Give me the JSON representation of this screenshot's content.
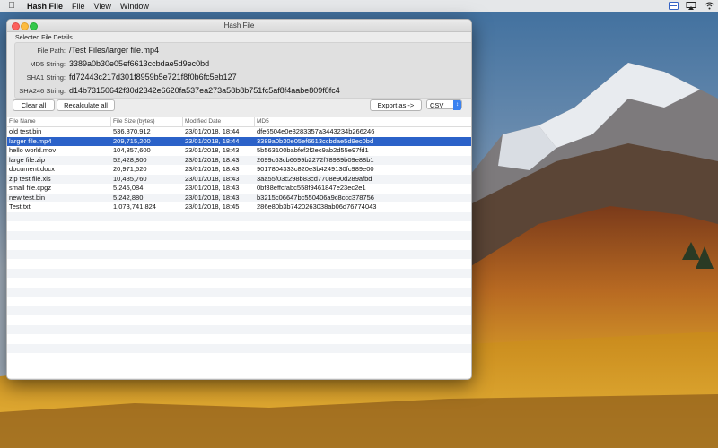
{
  "menubar": {
    "app_name": "Hash File",
    "menus": [
      "File",
      "View",
      "Window"
    ]
  },
  "window": {
    "title": "Hash File"
  },
  "details": {
    "section_title": "Selected File Details...",
    "file_path_label": "File Path:",
    "file_path_value": "/Test Files/larger file.mp4",
    "md5_label": "MD5 String:",
    "md5_value": "3389a0b30e05ef6613ccbdae5d9ec0bd",
    "sha1_label": "SHA1 String:",
    "sha1_value": "fd72443c217d301f8959b5e721f8f0b6fc5eb127",
    "sha256_label": "SHA246 String:",
    "sha256_value": "d14b73150642f30d2342e6620fa537ea273a58b8b751fc5af8f4aabe809f8fc4"
  },
  "toolbar": {
    "clear_all": "Clear all",
    "recalculate_all": "Recalculate all",
    "export_as": "Export as ->",
    "format_selected": "CSV"
  },
  "table": {
    "columns": [
      "File Name",
      "File Size (bytes)",
      "Modified Date",
      "MD5"
    ],
    "selected_index": 1,
    "rows": [
      [
        "old test.bin",
        "536,870,912",
        "23/01/2018, 18:44",
        "dfe6504e0e8283357a3443234b266246"
      ],
      [
        "larger file.mp4",
        "209,715,200",
        "23/01/2018, 18:44",
        "3389a0b30e05ef6613ccbdae5d9ec0bd"
      ],
      [
        "hello world.mov",
        "104,857,600",
        "23/01/2018, 18:43",
        "5b563100babfef2f2ec9ab2d55e97fd1"
      ],
      [
        "large file.zip",
        "52,428,800",
        "23/01/2018, 18:43",
        "2699c63cb6699b2272f78989b09e88b1"
      ],
      [
        "document.docx",
        "20,971,520",
        "23/01/2018, 18:43",
        "9017804333c820e3b4249130fc989e00"
      ],
      [
        "zip test file.xls",
        "10,485,760",
        "23/01/2018, 18:43",
        "3aa55f03c298b83cd7708e90d289afbd"
      ],
      [
        "small file.cpgz",
        "5,245,084",
        "23/01/2018, 18:43",
        "0bf38effcfabc558f9461847e23ec2e1"
      ],
      [
        "new test.bin",
        "5,242,880",
        "23/01/2018, 18:43",
        "b3215c06647bc550406a9c8ccc378756"
      ],
      [
        "Test.txt",
        "1,073,741,824",
        "23/01/2018, 18:45",
        "286e80b3b7420263038ab06d76774043"
      ]
    ]
  }
}
